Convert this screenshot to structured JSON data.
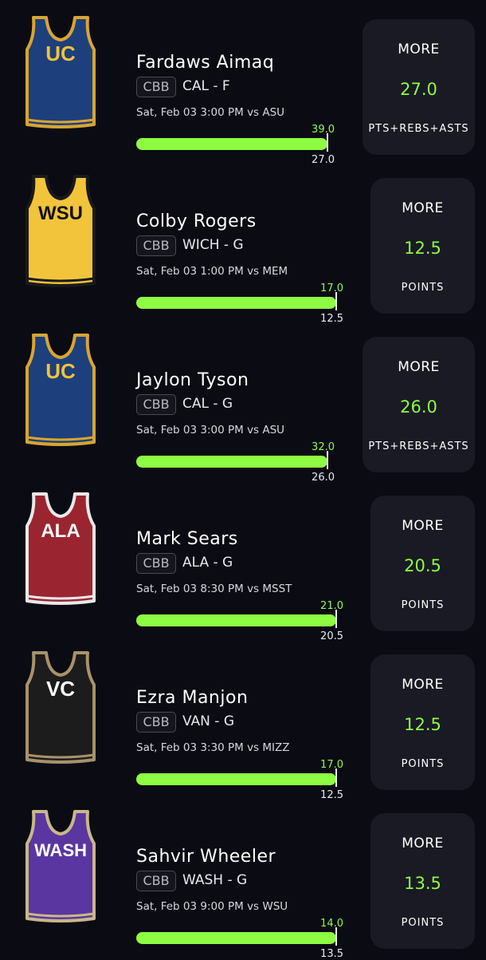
{
  "players": [
    {
      "name": "Fardaws Aimaq",
      "league": "CBB",
      "team_pos": "CAL - F",
      "game_info": "Sat, Feb 03 3:00 PM  vs ASU",
      "max_value": "39.0",
      "line_value": "27.0",
      "pick": "MORE",
      "stat": "PTS+REBS+ASTS",
      "jersey_text": "UC",
      "jersey_color": "#1d3f7c",
      "jersey_trim": "#d8a530",
      "jersey_text_color": "#f2c23a"
    },
    {
      "name": "Colby Rogers",
      "league": "CBB",
      "team_pos": "WICH - G",
      "game_info": "Sat, Feb 03 1:00 PM  vs MEM",
      "max_value": "17.0",
      "line_value": "12.5",
      "pick": "MORE",
      "stat": "POINTS",
      "jersey_text": "WSU",
      "jersey_color": "#f2c43c",
      "jersey_trim": "#1a1a1a",
      "jersey_text_color": "#111111"
    },
    {
      "name": "Jaylon Tyson",
      "league": "CBB",
      "team_pos": "CAL - G",
      "game_info": "Sat, Feb 03 3:00 PM  vs ASU",
      "max_value": "32.0",
      "line_value": "26.0",
      "pick": "MORE",
      "stat": "PTS+REBS+ASTS",
      "jersey_text": "UC",
      "jersey_color": "#1d3f7c",
      "jersey_trim": "#d8a530",
      "jersey_text_color": "#f2c23a"
    },
    {
      "name": "Mark Sears",
      "league": "CBB",
      "team_pos": "ALA - G",
      "game_info": "Sat, Feb 03 8:30 PM  vs MSST",
      "max_value": "21.0",
      "line_value": "20.5",
      "pick": "MORE",
      "stat": "POINTS",
      "jersey_text": "ALA",
      "jersey_color": "#9a2530",
      "jersey_trim": "#e8e8e8",
      "jersey_text_color": "#ffffff"
    },
    {
      "name": "Ezra Manjon",
      "league": "CBB",
      "team_pos": "VAN - G",
      "game_info": "Sat, Feb 03 3:30 PM  vs MIZZ",
      "max_value": "17.0",
      "line_value": "12.5",
      "pick": "MORE",
      "stat": "POINTS",
      "jersey_text": "VC",
      "jersey_color": "#1c1c1c",
      "jersey_trim": "#a8926a",
      "jersey_text_color": "#ffffff"
    },
    {
      "name": "Sahvir Wheeler",
      "league": "CBB",
      "team_pos": "WASH - G",
      "game_info": "Sat, Feb 03 9:00 PM  vs WSU",
      "max_value": "14.0",
      "line_value": "13.5",
      "pick": "MORE",
      "stat": "POINTS",
      "jersey_text": "WASH",
      "jersey_color": "#5a36a0",
      "jersey_trim": "#c8b888",
      "jersey_text_color": "#ffffff"
    }
  ],
  "colors": {
    "background": "#0b0b14",
    "card": "#1a1a24",
    "accent_green": "#8dfc43"
  }
}
